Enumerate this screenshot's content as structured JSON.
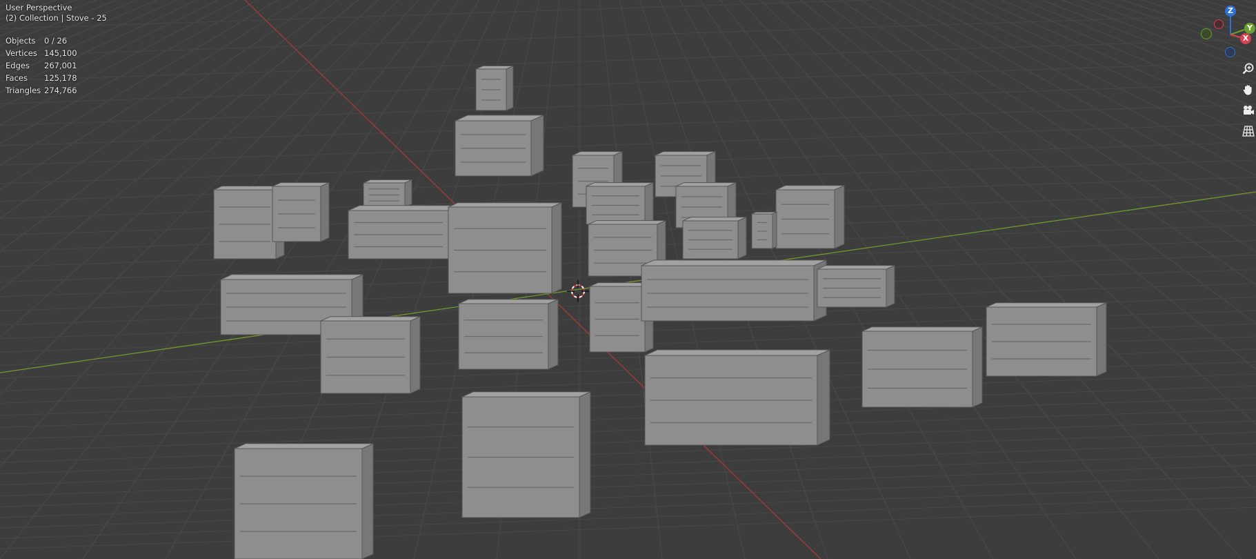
{
  "viewport": {
    "view_name": "User Perspective",
    "collection_line": "(2) Collection | Stove - 25",
    "background": "#3d3d3d",
    "x_axis_color": "#9a3a3a",
    "y_axis_color": "#6b8f2e"
  },
  "stats": [
    {
      "label": "Objects",
      "value": "0 / 26"
    },
    {
      "label": "Vertices",
      "value": "145,100"
    },
    {
      "label": "Edges",
      "value": "267,001"
    },
    {
      "label": "Faces",
      "value": "125,178"
    },
    {
      "label": "Triangles",
      "value": "274,766"
    }
  ],
  "gizmo": {
    "z_label": "Z",
    "y_label": "Y",
    "x_label": "X",
    "z_color": "#2f6fd8",
    "y_color": "#6aa12c",
    "x_color": "#d8414f"
  },
  "nav_tools": [
    {
      "name": "zoom-icon"
    },
    {
      "name": "hand-pan-icon"
    },
    {
      "name": "camera-icon"
    },
    {
      "name": "grid-ortho-icon"
    }
  ],
  "objects": {
    "mesh_color": "#8e8e8e",
    "count_visible": 26
  }
}
